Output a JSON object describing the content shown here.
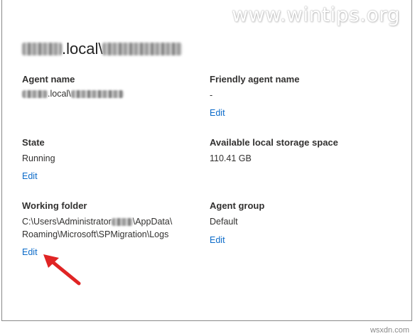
{
  "watermark": "www.wintips.org",
  "header": {
    "title_suffix": ".local\\"
  },
  "fields": {
    "agent_name": {
      "label": "Agent name",
      "value_suffix": ".local\\"
    },
    "friendly_agent_name": {
      "label": "Friendly agent name",
      "value": "-",
      "edit": "Edit"
    },
    "state": {
      "label": "State",
      "value": "Running",
      "edit": "Edit"
    },
    "storage": {
      "label": "Available local storage space",
      "value": "110.41 GB"
    },
    "working_folder": {
      "label": "Working folder",
      "line1_prefix": "C:\\Users\\Administrator",
      "line1_suffix": "\\AppData\\",
      "line2": "Roaming\\Microsoft\\SPMigration\\Logs",
      "edit": "Edit"
    },
    "agent_group": {
      "label": "Agent group",
      "value": "Default",
      "edit": "Edit"
    }
  },
  "footer": {
    "text": "wsxdn.com"
  },
  "colors": {
    "link": "#0a6ac9",
    "arrow": "#e02424",
    "text": "#323130"
  }
}
